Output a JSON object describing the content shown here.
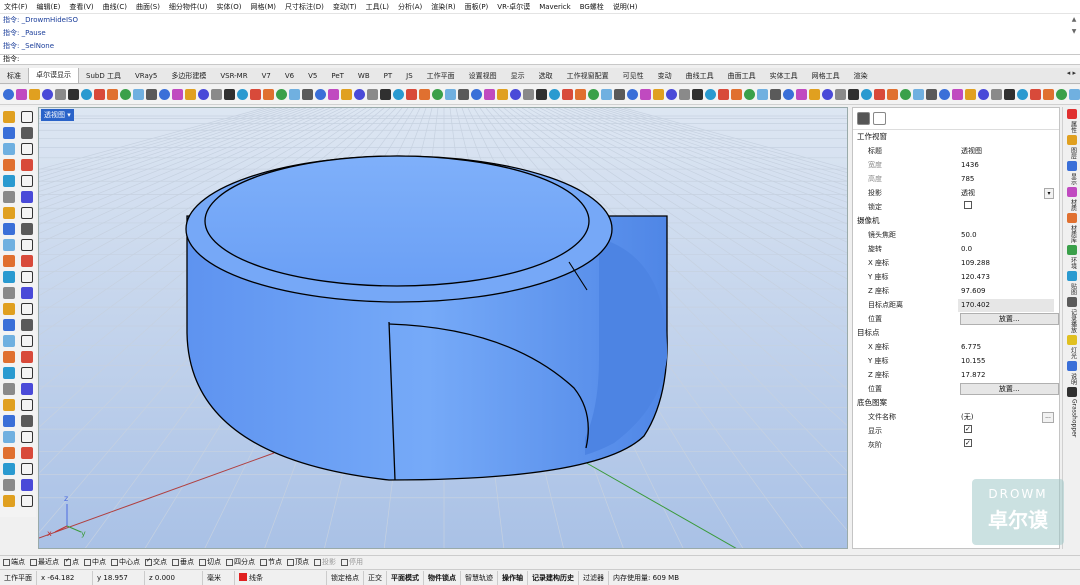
{
  "menu": [
    "文件(F)",
    "编辑(E)",
    "查看(V)",
    "曲线(C)",
    "曲面(S)",
    "细分物件(U)",
    "实体(O)",
    "网格(M)",
    "尺寸标注(D)",
    "变动(T)",
    "工具(L)",
    "分析(A)",
    "渲染(R)",
    "面板(P)",
    "VR-卓尔谟",
    "Maverick",
    "BG螺栓",
    "说明(H)"
  ],
  "command_history": [
    "指令: _DrowmHideISO",
    "指令: _Pause",
    "指令: _SelNone"
  ],
  "command_prompt": "指令:",
  "tabs": [
    "标准",
    "卓尔谟显示",
    "SubD 工具",
    "VRay5",
    "多边形建模",
    "VSR-MR",
    "V7",
    "V6",
    "V5",
    "PeT",
    "WB",
    "PT",
    "JS",
    "工作平面",
    "设置视图",
    "显示",
    "选取",
    "工作视窗配置",
    "可见性",
    "变动",
    "曲线工具",
    "曲面工具",
    "实体工具",
    "网格工具",
    "渲染"
  ],
  "active_tab": "卓尔谟显示",
  "viewport_label": "透视图",
  "panel": {
    "sections": {
      "viewport": "工作视窗",
      "camera": "摄像机",
      "target": "目标点",
      "wallpaper": "底色图案"
    },
    "viewport_rows": [
      {
        "k": "标题",
        "v": "透视图"
      },
      {
        "k": "宽度",
        "v": "1436"
      },
      {
        "k": "高度",
        "v": "785"
      },
      {
        "k": "投影",
        "v": "透视"
      },
      {
        "k": "锁定",
        "v": ""
      }
    ],
    "camera_rows": [
      {
        "k": "镜头焦距",
        "v": "50.0"
      },
      {
        "k": "旋转",
        "v": "0.0"
      },
      {
        "k": "X 座标",
        "v": "109.288"
      },
      {
        "k": "Y 座标",
        "v": "120.473"
      },
      {
        "k": "Z 座标",
        "v": "97.609"
      },
      {
        "k": "目标点距离",
        "v": "170.402"
      },
      {
        "k": "位置",
        "v": "放置..."
      }
    ],
    "target_rows": [
      {
        "k": "X 座标",
        "v": "6.775"
      },
      {
        "k": "Y 座标",
        "v": "10.155"
      },
      {
        "k": "Z 座标",
        "v": "17.872"
      },
      {
        "k": "位置",
        "v": "放置..."
      }
    ],
    "wallpaper_rows": [
      {
        "k": "文件名称",
        "v": "(无)"
      },
      {
        "k": "显示",
        "v": ""
      },
      {
        "k": "灰阶",
        "v": ""
      }
    ],
    "browse_label": "..."
  },
  "sidestrip": [
    "属性",
    "图层",
    "显示",
    "材质",
    "材质库",
    "环境",
    "贴图",
    "记录播放",
    "灯光",
    "说明",
    "Grasshopper"
  ],
  "osnap": [
    {
      "label": "端点",
      "on": false
    },
    {
      "label": "最近点",
      "on": false
    },
    {
      "label": "点",
      "on": true
    },
    {
      "label": "中点",
      "on": false
    },
    {
      "label": "中心点",
      "on": false
    },
    {
      "label": "交点",
      "on": true
    },
    {
      "label": "垂点",
      "on": false
    },
    {
      "label": "切点",
      "on": false
    },
    {
      "label": "四分点",
      "on": false
    },
    {
      "label": "节点",
      "on": false
    },
    {
      "label": "顶点",
      "on": false
    },
    {
      "label": "投影",
      "on": false,
      "dim": true
    },
    {
      "label": "停用",
      "on": false,
      "dim": true
    }
  ],
  "status": {
    "plane": "工作平面",
    "x": "x -64.182",
    "y": "y 18.957",
    "z": "z 0.000",
    "units": "毫米",
    "layer": "线条",
    "toggles": [
      "锁定格点",
      "正交",
      "平面模式",
      "物件锁点",
      "智慧轨迹",
      "操作轴",
      "记录建构历史",
      "过滤器"
    ],
    "bold_toggles": [
      "平面模式",
      "物件锁点",
      "操作轴",
      "记录建构历史"
    ],
    "memory": "内存使用量: 609 MB"
  },
  "axis": {
    "x": "x",
    "y": "y",
    "z": "z"
  },
  "watermark": {
    "line1": "DROWM",
    "line2": "卓尔谟"
  },
  "colors": {
    "viewport_top": "#dde6f2",
    "viewport_bottom": "#a9c1e6",
    "object_blue": "#6ea2f5",
    "grid": "#c6d1e0",
    "accent": "#2a63c9"
  }
}
